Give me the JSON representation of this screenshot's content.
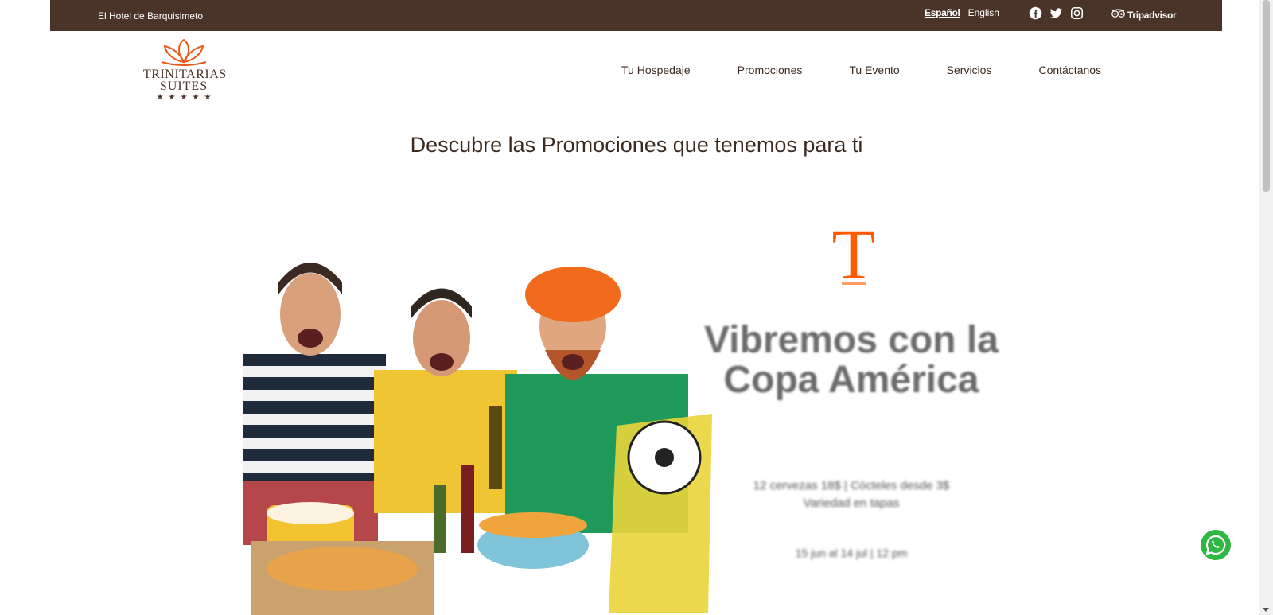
{
  "topbar": {
    "tagline": "El Hotel de Barquisimeto",
    "languages": [
      {
        "label": "Español",
        "active": true
      },
      {
        "label": "English",
        "active": false
      }
    ],
    "social_icons": [
      "facebook-icon",
      "twitter-icon",
      "instagram-icon"
    ],
    "tripadvisor_label": "Tripadvisor"
  },
  "logo": {
    "line1": "TRINITARIAS",
    "line2": "SUITES",
    "stars": "★★★★★"
  },
  "nav": {
    "items": [
      "Tu Hospedaje",
      "Promociones",
      "Tu Evento",
      "Servicios",
      "Contáctanos"
    ]
  },
  "main": {
    "headline": "Descubre las Promociones que tenemos para ti"
  },
  "promo": {
    "title": "Vibremos con la Copa América",
    "details_line1": "12 cervezas 18$ | Cócteles desde 3$",
    "details_line2": "Variedad en tapas",
    "dates": "15 jun al 14 jul | 12 pm"
  },
  "colors": {
    "topbar_bg": "#4a3328",
    "brand_orange": "#e8591a",
    "whatsapp_green": "#2fb744"
  }
}
